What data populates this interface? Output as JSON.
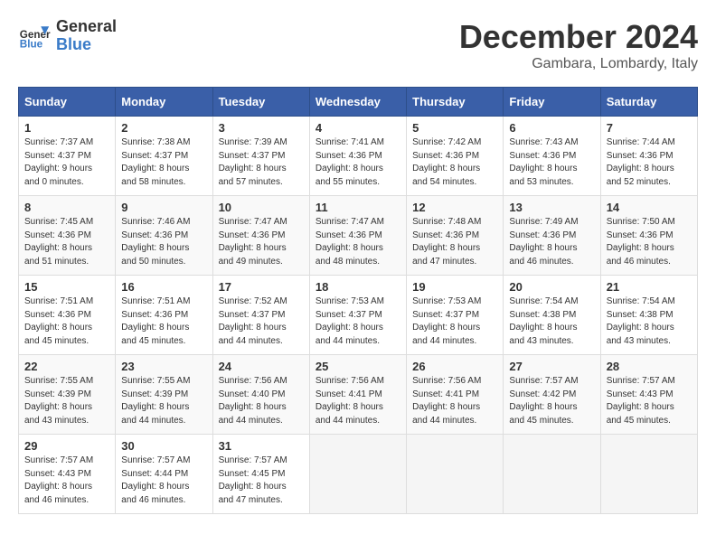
{
  "header": {
    "logo_line1": "General",
    "logo_line2": "Blue",
    "title": "December 2024",
    "subtitle": "Gambara, Lombardy, Italy"
  },
  "weekdays": [
    "Sunday",
    "Monday",
    "Tuesday",
    "Wednesday",
    "Thursday",
    "Friday",
    "Saturday"
  ],
  "weeks": [
    [
      {
        "day": "1",
        "info": "Sunrise: 7:37 AM\nSunset: 4:37 PM\nDaylight: 9 hours\nand 0 minutes."
      },
      {
        "day": "2",
        "info": "Sunrise: 7:38 AM\nSunset: 4:37 PM\nDaylight: 8 hours\nand 58 minutes."
      },
      {
        "day": "3",
        "info": "Sunrise: 7:39 AM\nSunset: 4:37 PM\nDaylight: 8 hours\nand 57 minutes."
      },
      {
        "day": "4",
        "info": "Sunrise: 7:41 AM\nSunset: 4:36 PM\nDaylight: 8 hours\nand 55 minutes."
      },
      {
        "day": "5",
        "info": "Sunrise: 7:42 AM\nSunset: 4:36 PM\nDaylight: 8 hours\nand 54 minutes."
      },
      {
        "day": "6",
        "info": "Sunrise: 7:43 AM\nSunset: 4:36 PM\nDaylight: 8 hours\nand 53 minutes."
      },
      {
        "day": "7",
        "info": "Sunrise: 7:44 AM\nSunset: 4:36 PM\nDaylight: 8 hours\nand 52 minutes."
      }
    ],
    [
      {
        "day": "8",
        "info": "Sunrise: 7:45 AM\nSunset: 4:36 PM\nDaylight: 8 hours\nand 51 minutes."
      },
      {
        "day": "9",
        "info": "Sunrise: 7:46 AM\nSunset: 4:36 PM\nDaylight: 8 hours\nand 50 minutes."
      },
      {
        "day": "10",
        "info": "Sunrise: 7:47 AM\nSunset: 4:36 PM\nDaylight: 8 hours\nand 49 minutes."
      },
      {
        "day": "11",
        "info": "Sunrise: 7:47 AM\nSunset: 4:36 PM\nDaylight: 8 hours\nand 48 minutes."
      },
      {
        "day": "12",
        "info": "Sunrise: 7:48 AM\nSunset: 4:36 PM\nDaylight: 8 hours\nand 47 minutes."
      },
      {
        "day": "13",
        "info": "Sunrise: 7:49 AM\nSunset: 4:36 PM\nDaylight: 8 hours\nand 46 minutes."
      },
      {
        "day": "14",
        "info": "Sunrise: 7:50 AM\nSunset: 4:36 PM\nDaylight: 8 hours\nand 46 minutes."
      }
    ],
    [
      {
        "day": "15",
        "info": "Sunrise: 7:51 AM\nSunset: 4:36 PM\nDaylight: 8 hours\nand 45 minutes."
      },
      {
        "day": "16",
        "info": "Sunrise: 7:51 AM\nSunset: 4:36 PM\nDaylight: 8 hours\nand 45 minutes."
      },
      {
        "day": "17",
        "info": "Sunrise: 7:52 AM\nSunset: 4:37 PM\nDaylight: 8 hours\nand 44 minutes."
      },
      {
        "day": "18",
        "info": "Sunrise: 7:53 AM\nSunset: 4:37 PM\nDaylight: 8 hours\nand 44 minutes."
      },
      {
        "day": "19",
        "info": "Sunrise: 7:53 AM\nSunset: 4:37 PM\nDaylight: 8 hours\nand 44 minutes."
      },
      {
        "day": "20",
        "info": "Sunrise: 7:54 AM\nSunset: 4:38 PM\nDaylight: 8 hours\nand 43 minutes."
      },
      {
        "day": "21",
        "info": "Sunrise: 7:54 AM\nSunset: 4:38 PM\nDaylight: 8 hours\nand 43 minutes."
      }
    ],
    [
      {
        "day": "22",
        "info": "Sunrise: 7:55 AM\nSunset: 4:39 PM\nDaylight: 8 hours\nand 43 minutes."
      },
      {
        "day": "23",
        "info": "Sunrise: 7:55 AM\nSunset: 4:39 PM\nDaylight: 8 hours\nand 44 minutes."
      },
      {
        "day": "24",
        "info": "Sunrise: 7:56 AM\nSunset: 4:40 PM\nDaylight: 8 hours\nand 44 minutes."
      },
      {
        "day": "25",
        "info": "Sunrise: 7:56 AM\nSunset: 4:41 PM\nDaylight: 8 hours\nand 44 minutes."
      },
      {
        "day": "26",
        "info": "Sunrise: 7:56 AM\nSunset: 4:41 PM\nDaylight: 8 hours\nand 44 minutes."
      },
      {
        "day": "27",
        "info": "Sunrise: 7:57 AM\nSunset: 4:42 PM\nDaylight: 8 hours\nand 45 minutes."
      },
      {
        "day": "28",
        "info": "Sunrise: 7:57 AM\nSunset: 4:43 PM\nDaylight: 8 hours\nand 45 minutes."
      }
    ],
    [
      {
        "day": "29",
        "info": "Sunrise: 7:57 AM\nSunset: 4:43 PM\nDaylight: 8 hours\nand 46 minutes."
      },
      {
        "day": "30",
        "info": "Sunrise: 7:57 AM\nSunset: 4:44 PM\nDaylight: 8 hours\nand 46 minutes."
      },
      {
        "day": "31",
        "info": "Sunrise: 7:57 AM\nSunset: 4:45 PM\nDaylight: 8 hours\nand 47 minutes."
      },
      {
        "day": "",
        "info": ""
      },
      {
        "day": "",
        "info": ""
      },
      {
        "day": "",
        "info": ""
      },
      {
        "day": "",
        "info": ""
      }
    ]
  ]
}
